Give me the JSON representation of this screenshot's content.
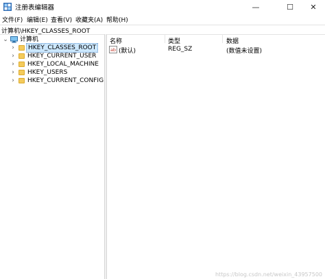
{
  "window": {
    "title": "注册表编辑器",
    "minimize_glyph": "—",
    "maximize_glyph": "☐",
    "close_glyph": "✕"
  },
  "menu": [
    "文件(F)",
    "编辑(E)",
    "查看(V)",
    "收藏夹(A)",
    "帮助(H)"
  ],
  "address": "计算机\\HKEY_CLASSES_ROOT",
  "tree": {
    "root_label": "计算机",
    "root_expander": "⌄",
    "child_expander": "›",
    "selected": "HKEY_CLASSES_ROOT",
    "children": [
      "HKEY_CLASSES_ROOT",
      "HKEY_CURRENT_USER",
      "HKEY_LOCAL_MACHINE",
      "HKEY_USERS",
      "HKEY_CURRENT_CONFIG"
    ]
  },
  "list": {
    "headers": {
      "name": "名称",
      "type": "类型",
      "data": "数据"
    },
    "rows": [
      {
        "icon": "string-value-icon",
        "icon_text": "ab",
        "name": "(默认)",
        "type": "REG_SZ",
        "data": "(数值未设置)"
      }
    ]
  },
  "watermark": "https://blog.csdn.net/weixin_43957500",
  "colors": {
    "selection": "#cce8ff",
    "folder": "#f4cb5c",
    "reg_icon": "#c0392b"
  }
}
